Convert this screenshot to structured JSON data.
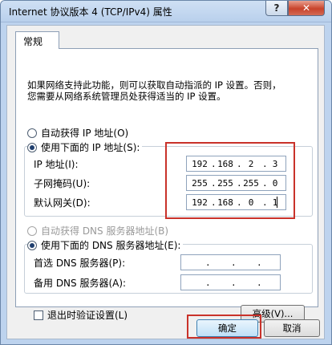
{
  "window": {
    "title": "Internet 协议版本 4 (TCP/IPv4) 属性",
    "help_glyph": "?",
    "close_glyph": "✕"
  },
  "tabs": [
    {
      "label": "常规"
    }
  ],
  "description": {
    "line1": "如果网络支持此功能，则可以获取自动指派的 IP 设置。否则，",
    "line2": "您需要从网络系统管理员处获得适当的 IP 设置。"
  },
  "ip": {
    "auto_label": "自动获得 IP 地址(O)",
    "manual_label": "使用下面的 IP 地址(S):",
    "selected": "manual",
    "ip_address": {
      "label": "IP 地址(I):",
      "octets": [
        "192",
        "168",
        "2",
        "3"
      ]
    },
    "subnet_mask": {
      "label": "子网掩码(U):",
      "octets": [
        "255",
        "255",
        "255",
        "0"
      ]
    },
    "gateway": {
      "label": "默认网关(D):",
      "octets": [
        "192",
        "168",
        "0",
        "1"
      ]
    }
  },
  "dns": {
    "auto_label": "自动获得 DNS 服务器地址(B)",
    "manual_label": "使用下面的 DNS 服务器地址(E):",
    "selected": "manual",
    "preferred": {
      "label": "首选 DNS 服务器(P):",
      "octets": [
        "",
        "",
        "",
        ""
      ]
    },
    "alternate": {
      "label": "备用 DNS 服务器(A):",
      "octets": [
        "",
        "",
        "",
        ""
      ]
    }
  },
  "footer": {
    "validate_label": "退出时验证设置(L)",
    "advanced_label": "高级(V)...",
    "ok_label": "确定",
    "cancel_label": "取消"
  },
  "colors": {
    "highlight": "#c9322a",
    "titlebar": "#bdd3ee"
  }
}
